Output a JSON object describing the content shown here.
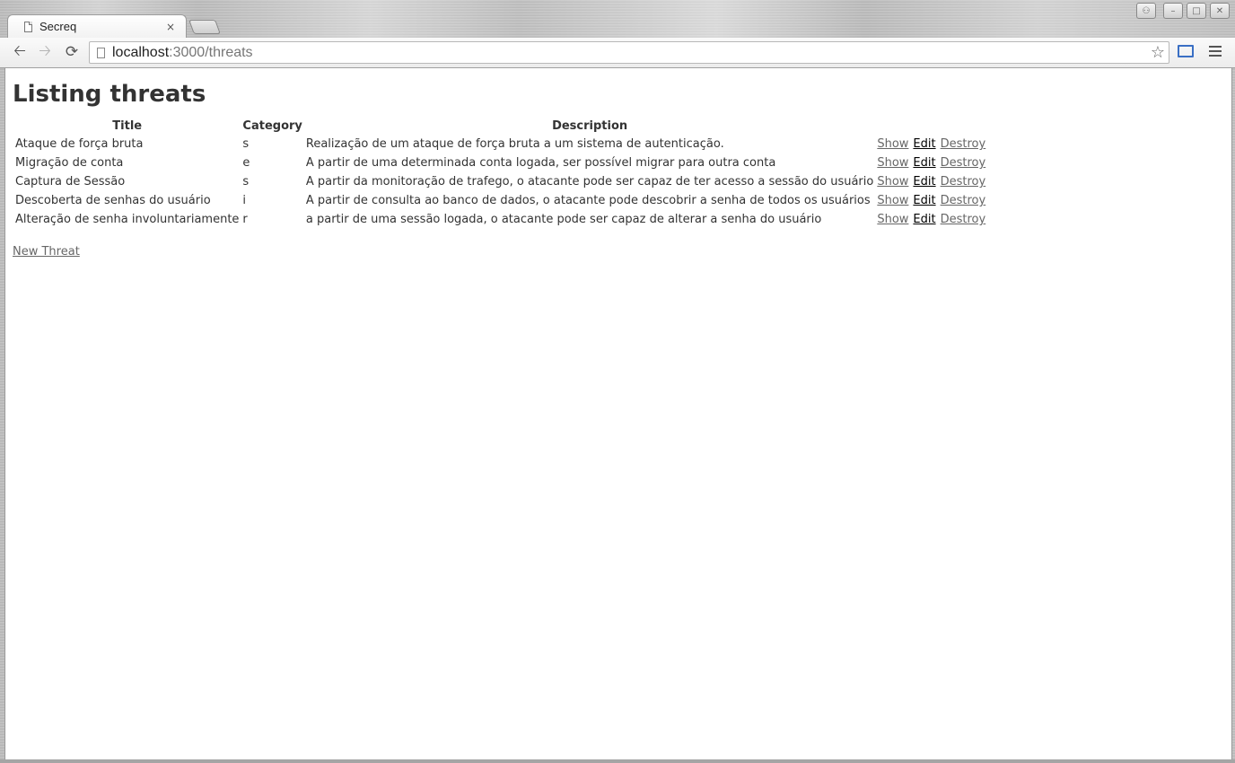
{
  "browser": {
    "tab_title": "Secreq",
    "tab_close": "×",
    "url_host": "localhost",
    "url_rest": ":3000/threats"
  },
  "page": {
    "heading": "Listing threats",
    "columns": [
      "Title",
      "Category",
      "Description"
    ],
    "rows": [
      {
        "title": "Ataque de força bruta",
        "category": "s",
        "description": "Realização de um ataque de força bruta a um sistema de autenticação."
      },
      {
        "title": "Migração de conta",
        "category": "e",
        "description": "A partir de uma determinada conta logada, ser possível migrar para outra conta"
      },
      {
        "title": "Captura de Sessão",
        "category": "s",
        "description": "A partir da monitoração de trafego, o atacante pode ser capaz de ter acesso a sessão do usuário"
      },
      {
        "title": "Descoberta de senhas do usuário",
        "category": "i",
        "description": "A partir de consulta ao banco de dados, o atacante pode descobrir a senha de todos os usuários"
      },
      {
        "title": "Alteração de senha involuntariamente",
        "category": "r",
        "description": "a partir de uma sessão logada, o atacante pode ser capaz de alterar a senha do usuário"
      }
    ],
    "actions": {
      "show": "Show",
      "edit": "Edit",
      "destroy": "Destroy"
    },
    "new_link": "New Threat"
  }
}
